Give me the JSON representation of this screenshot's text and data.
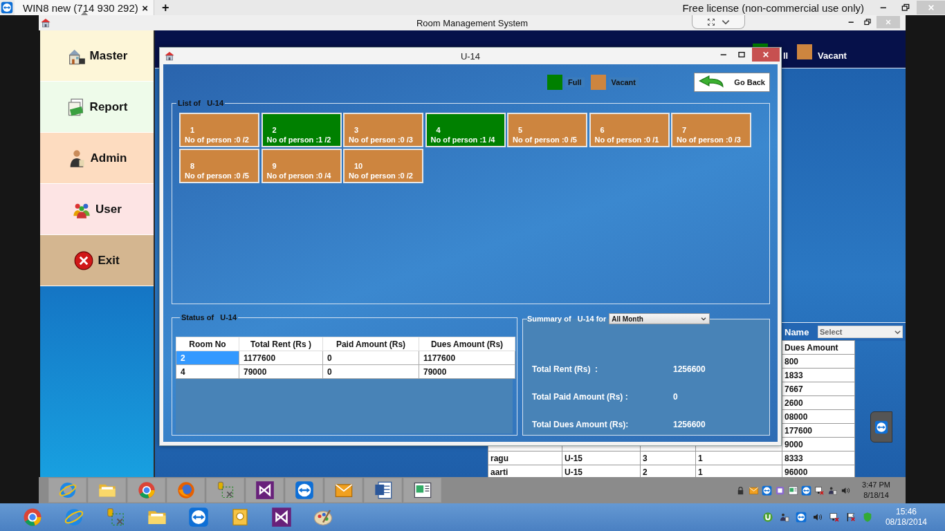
{
  "remote_session": {
    "tab_title": "WIN8 new (714 930 292)",
    "tab_close": "×",
    "new_tab": "+",
    "license_notice": "Free license (non-commercial use only)"
  },
  "app_window": {
    "title": "Room Management System"
  },
  "menu": [
    {
      "label": "Master",
      "kind": "master",
      "color": "#fdf6d8"
    },
    {
      "label": "Report",
      "kind": "report",
      "color": "#eefbea"
    },
    {
      "label": "Admin",
      "kind": "admin",
      "color": "#fddcc0"
    },
    {
      "label": "User",
      "kind": "user",
      "color": "#fde4e4"
    },
    {
      "label": "Exit",
      "kind": "exit",
      "color": "#d4b690"
    }
  ],
  "background_view": {
    "legend": [
      {
        "label": "ll",
        "color": "#008000"
      },
      {
        "label": "Vacant",
        "color": "#cd853f"
      }
    ],
    "filter": {
      "label": "Name",
      "placeholder": "Select"
    },
    "table": {
      "dues_header": "Dues Amount",
      "rows": [
        {
          "dues": "800"
        },
        {
          "dues": "1833"
        },
        {
          "dues": "7667"
        },
        {
          "dues": "2600"
        },
        {
          "dues": "08000"
        },
        {
          "dues": "177600"
        },
        {
          "dues": "9000"
        },
        {
          "cells": [
            "ragu",
            "U-15",
            "3",
            "1"
          ],
          "dues": "8333"
        },
        {
          "cells": [
            "aarti",
            "U-15",
            "2",
            "1"
          ],
          "dues": "96000"
        }
      ]
    }
  },
  "dialog": {
    "title": "U-14",
    "legend": [
      {
        "label": "Full",
        "color": "#008000"
      },
      {
        "label": "Vacant",
        "color": "#cd853f"
      }
    ],
    "go_back": "Go Back",
    "list_title": "List of   U-14",
    "rooms": [
      {
        "number": "1",
        "occupancy": "No of person :0 /2",
        "full": false
      },
      {
        "number": "2",
        "occupancy": "No of person :1 /2",
        "full": true
      },
      {
        "number": "3",
        "occupancy": "No of person :0 /3",
        "full": false
      },
      {
        "number": "4",
        "occupancy": "No of person :1 /4",
        "full": true
      },
      {
        "number": "5",
        "occupancy": "No of person :0 /5",
        "full": false
      },
      {
        "number": "6",
        "occupancy": "No of person :0 /1",
        "full": false
      },
      {
        "number": "7",
        "occupancy": "No of person :0 /3",
        "full": false
      },
      {
        "number": "8",
        "occupancy": "No of person :0 /5",
        "full": false
      },
      {
        "number": "9",
        "occupancy": "No of person :0 /4",
        "full": false
      },
      {
        "number": "10",
        "occupancy": "No of person :0 /2",
        "full": false
      }
    ],
    "status_title": "Status of   U-14",
    "table": {
      "columns": [
        "Room No",
        "Total Rent (Rs )",
        "Paid Amount (Rs)",
        "Dues Amount (Rs)"
      ],
      "rows": [
        {
          "cells": [
            "2",
            "1177600",
            "0",
            "1177600"
          ],
          "selected": true
        },
        {
          "cells": [
            "4",
            "79000",
            "0",
            "79000"
          ],
          "selected": false
        }
      ]
    },
    "summary": {
      "title": "Summary of   U-14 for",
      "period": "All Month",
      "items": [
        {
          "label": "Total Rent (Rs)  :",
          "value": "1256600"
        },
        {
          "label": "Total Paid Amount (Rs) :",
          "value": "0"
        },
        {
          "label": "Total Dues Amount (Rs):",
          "value": "1256600"
        }
      ]
    }
  },
  "remote_taskbar": {
    "time": "3:47 PM",
    "date": "8/18/14"
  },
  "local_taskbar": {
    "time": "15:46",
    "date": "08/18/2014"
  }
}
